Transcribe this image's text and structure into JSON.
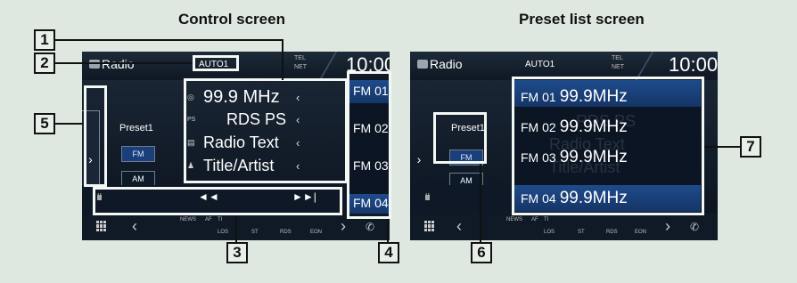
{
  "headings": {
    "left": "Control screen",
    "right": "Preset list screen"
  },
  "control_screen": {
    "title": "Radio",
    "auto_badge": "AUTO1",
    "status": {
      "tel": "TEL",
      "net": "NET"
    },
    "clock": "10:00",
    "side_tab_arrow": "›",
    "preset_label": "Preset1",
    "bands": [
      {
        "label": "FM",
        "active": true
      },
      {
        "label": "AM",
        "active": false
      }
    ],
    "info_rows": [
      {
        "icon": "tuning-icon",
        "text": "99.9 MHz"
      },
      {
        "icon": "ps-icon",
        "icon_text": "PS",
        "text": "RDS PS"
      },
      {
        "icon": "radio-text-icon",
        "text": "Radio Text"
      },
      {
        "icon": "person-icon",
        "text": "Title/Artist"
      }
    ],
    "presets_partial": [
      "FM 01",
      "FM 02",
      "FM 03",
      "FM 04"
    ],
    "controls": {
      "eq": "ılıılı",
      "prev": "◄◄",
      "next": "►►|"
    },
    "bottom": {
      "labels": [
        "NEWS",
        "AF",
        "TI",
        "LOS",
        "ST",
        "RDS",
        "EON"
      ]
    }
  },
  "preset_screen": {
    "title": "Radio",
    "auto_badge": "AUTO1",
    "status": {
      "tel": "TEL",
      "net": "NET"
    },
    "clock": "10:00",
    "side_tab_arrow": "›",
    "preset_label": "Preset1",
    "bands": [
      {
        "label": "FM",
        "active": true
      },
      {
        "label": "AM",
        "active": false
      }
    ],
    "presets": [
      {
        "num": "FM 01",
        "freq": "99.9MHz"
      },
      {
        "num": "FM 02",
        "freq": "99.9MHz"
      },
      {
        "num": "FM 03",
        "freq": "99.9MHz"
      },
      {
        "num": "FM 04",
        "freq": "99.9MHz"
      }
    ],
    "ghost_texts": [
      "RDS PS",
      "Radio Text",
      "Title/Artist"
    ],
    "controls": {
      "eq": "ılıılı"
    },
    "bottom": {
      "labels": [
        "NEWS",
        "AF",
        "TI",
        "LOS",
        "ST",
        "RDS",
        "EON"
      ]
    }
  },
  "callouts": [
    "1",
    "2",
    "3",
    "4",
    "5",
    "6",
    "7"
  ],
  "colors": {
    "background": "#dfe8e0",
    "screen": "#0a1420",
    "highlight_blue": "#1e4b8c",
    "callout_border": "#111111"
  }
}
